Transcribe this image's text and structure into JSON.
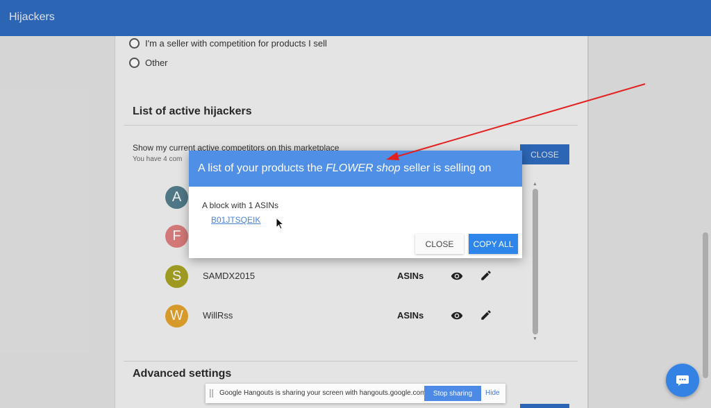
{
  "app": {
    "title": "Hijackers"
  },
  "options": [
    {
      "label": "I'm a seller with competition for products I sell"
    },
    {
      "label": "Other"
    }
  ],
  "active_hijackers": {
    "title": "List of active hijackers",
    "description": "Show my current active competitors on this marketplace",
    "sub": "You have 4 com",
    "close_label": "CLOSE",
    "competitors": [
      {
        "initial": "A",
        "color": "#547f8f",
        "name": "",
        "asins": ""
      },
      {
        "initial": "F",
        "color": "#e08080",
        "name": "",
        "asins": ""
      },
      {
        "initial": "S",
        "color": "#a8a424",
        "name": "SAMDX2015",
        "asins": "ASINs"
      },
      {
        "initial": "W",
        "color": "#e3a42c",
        "name": "WillRss",
        "asins": "ASINs"
      }
    ]
  },
  "modal": {
    "title_prefix": "A list of your products the ",
    "title_emphasis": "FLOWER shop",
    "title_suffix": " seller is selling on",
    "block_label": "A block with 1 ASINs",
    "asins": [
      "B01JTSQEIK"
    ],
    "close_label": "CLOSE",
    "copy_label": "COPY ALL"
  },
  "advanced": {
    "title": "Advanced settings"
  },
  "share_bar": {
    "text": "Google Hangouts is sharing your screen with hangouts.google.com.",
    "stop_label": "Stop sharing",
    "hide_label": "Hide"
  },
  "colors": {
    "header": "#2f6cc0",
    "modal_header": "#4f8fe6",
    "primary_button": "#2f86ea",
    "annotation_arrow": "#e32020"
  }
}
